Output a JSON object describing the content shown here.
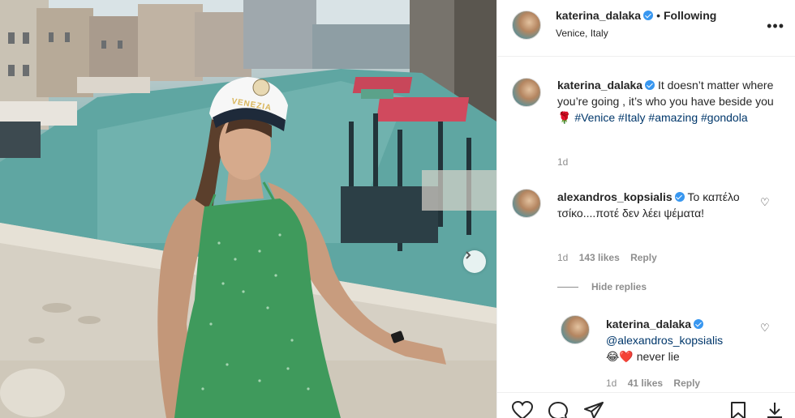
{
  "post": {
    "username": "katerina_dalaka",
    "follow_status": "Following",
    "separator": "•",
    "location": "Venice, Italy"
  },
  "caption": {
    "username": "katerina_dalaka",
    "text": "It doesn’t matter where you’re going , it’s who you have beside you",
    "emoji": "🌹",
    "hashtags": [
      "#Venice",
      "#Italy",
      "#amazing",
      "#gondola"
    ],
    "age": "1d"
  },
  "comments": [
    {
      "username": "alexandros_kopsialis",
      "text": "Το καπέλο τσίκο....ποτέ δεν λέει ψέματα!",
      "age": "1d",
      "likes": "143 likes",
      "reply_label": "Reply",
      "hide_replies_label": "Hide replies",
      "replies": [
        {
          "username": "katerina_dalaka",
          "mention": "@alexandros_kopsialis",
          "emoji": "😂❤️",
          "text": "never lie",
          "age": "1d",
          "likes": "41 likes",
          "reply_label": "Reply"
        }
      ]
    }
  ],
  "photo": {
    "hat_text": "VENEZIA"
  },
  "icons": {
    "more": "more-dots-icon",
    "like": "heart-icon",
    "comment": "comment-bubble-icon",
    "share": "paper-plane-icon",
    "save": "bookmark-icon",
    "next": "chevron-right-icon"
  },
  "colors": {
    "verified": "#3897f0",
    "hashtag": "#00376b",
    "meta": "#8e8e8e",
    "dress": "#3f9a5c"
  }
}
